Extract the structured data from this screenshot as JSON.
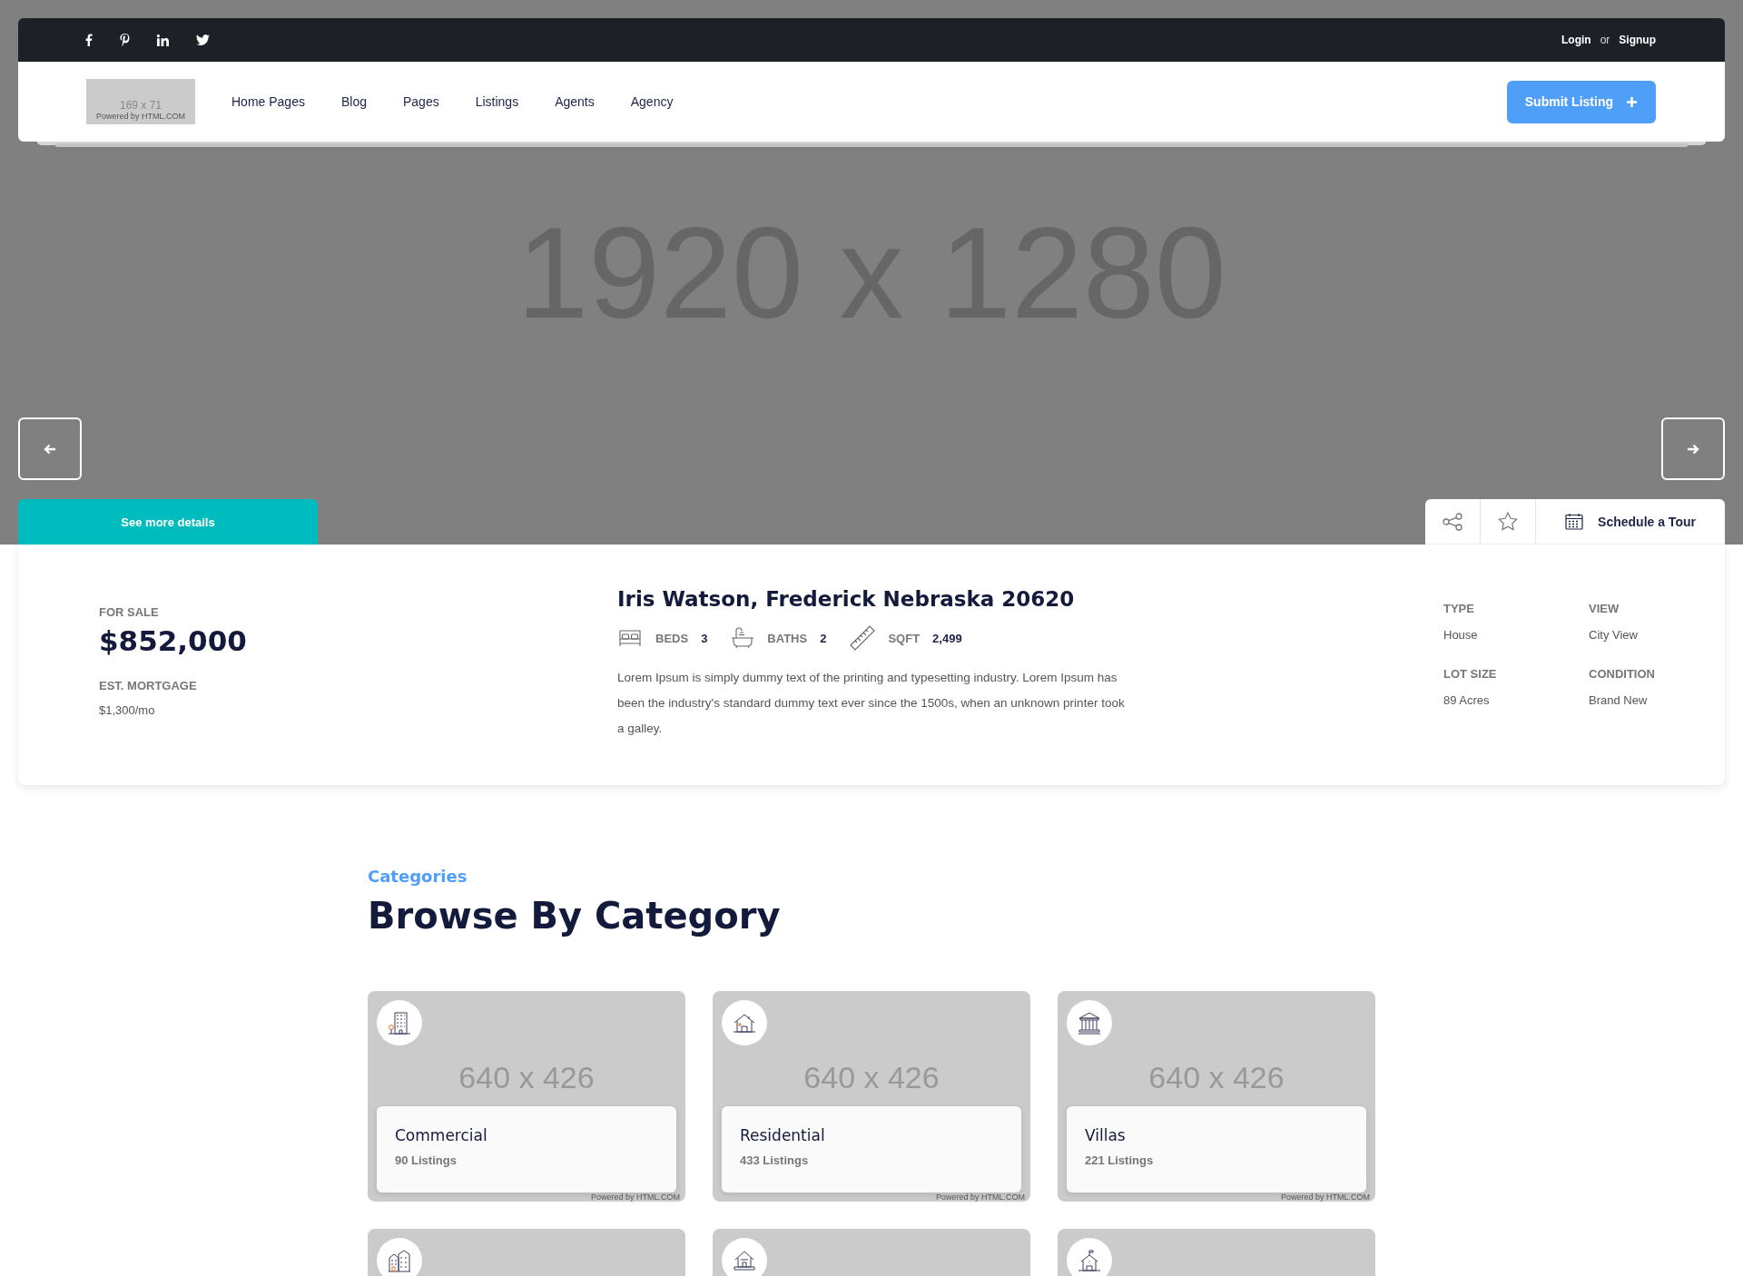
{
  "top_bar": {
    "login": "Login",
    "or": "or",
    "signup": "Signup"
  },
  "header": {
    "logo": {
      "size": "169 x 71",
      "credit": "Powered by HTML.COM"
    },
    "nav": [
      "Home Pages",
      "Blog",
      "Pages",
      "Listings",
      "Agents",
      "Agency"
    ],
    "submit": "Submit Listing"
  },
  "hero": {
    "placeholder": "1920 x 1280",
    "see_more": "See more details",
    "schedule": "Schedule a Tour"
  },
  "listing": {
    "status": "FOR SALE",
    "price": "$852,000",
    "mortgage_label": "EST. MORTGAGE",
    "mortgage": "$1,300/mo",
    "title": "Iris Watson, Frederick Nebraska 20620",
    "specs": [
      {
        "label": "BEDS",
        "value": "3"
      },
      {
        "label": "BATHS",
        "value": "2"
      },
      {
        "label": "SQFT",
        "value": "2,499"
      }
    ],
    "description": "Lorem Ipsum is simply dummy text of the printing and typesetting industry. Lorem Ipsum has been the industry's standard dummy text ever since the 1500s, when an unknown printer took a galley.",
    "facts": [
      {
        "label": "TYPE",
        "value": "House"
      },
      {
        "label": "VIEW",
        "value": "City View"
      },
      {
        "label": "LOT SIZE",
        "value": "89 Acres"
      },
      {
        "label": "CONDITION",
        "value": "Brand New"
      }
    ]
  },
  "categories": {
    "eyebrow": "Categories",
    "title": "Browse By Category",
    "cards": [
      {
        "kind": "picture",
        "placeholder": "640 x 426",
        "name": "Commercial",
        "count": "90 Listings",
        "credit": "Powered by HTML.COM"
      },
      {
        "kind": "picture",
        "placeholder": "640 x 426",
        "name": "Residential",
        "count": "433 Listings",
        "credit": "Powered by HTML.COM"
      },
      {
        "kind": "picture",
        "placeholder": "640 x 426",
        "name": "Villas",
        "count": "221 Listings",
        "credit": "Powered by HTML.COM"
      },
      {
        "kind": "picture"
      },
      {
        "kind": "picture"
      },
      {
        "kind": "picture"
      }
    ]
  }
}
